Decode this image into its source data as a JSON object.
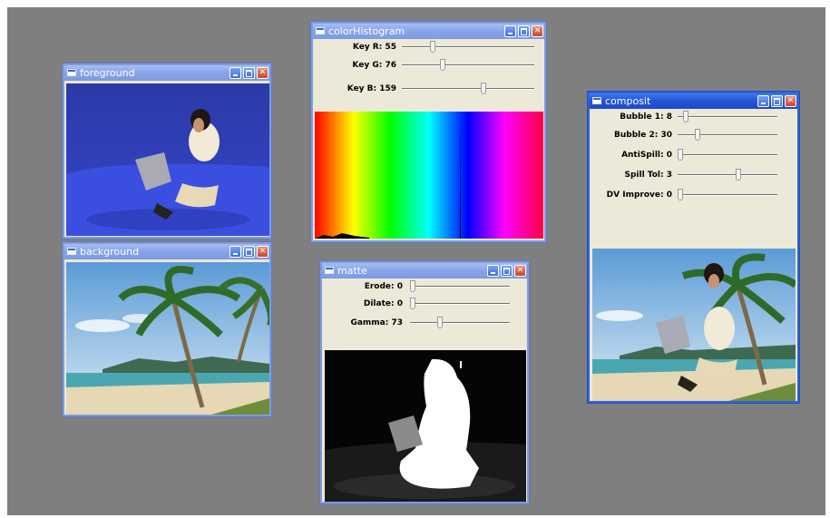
{
  "windows": {
    "foreground": {
      "title": "foreground"
    },
    "background": {
      "title": "background"
    },
    "colorHistogram": {
      "title": "colorHistogram",
      "sliders": [
        {
          "label": "Key R: 55",
          "level": 0.22
        },
        {
          "label": "Key G: 76",
          "level": 0.3
        },
        {
          "label": "Key B: 159",
          "level": 0.62
        }
      ]
    },
    "matte": {
      "title": "matte",
      "sliders": [
        {
          "label": "Erode: 0",
          "level": 0.0
        },
        {
          "label": "Dilate: 0",
          "level": 0.0
        },
        {
          "label": "Gamma: 73",
          "level": 0.29
        }
      ]
    },
    "composit": {
      "title": "composit",
      "sliders": [
        {
          "label": "Bubble 1: 8",
          "level": 0.06
        },
        {
          "label": "Bubble 2: 30",
          "level": 0.18
        },
        {
          "label": "AntiSpill: 0",
          "level": 0.0
        },
        {
          "label": "Spill Tol: 3",
          "level": 0.62
        },
        {
          "label": "DV Improve: 0",
          "level": 0.0
        }
      ]
    }
  },
  "icons": [
    "window-menu-icon",
    "minimize-icon",
    "maximize-icon",
    "close-icon"
  ],
  "colors": {
    "desktop": "#7f7f7f",
    "titlebar_active": "#2456d8",
    "titlebar_inactive": "#8aa6ea",
    "chroma_blue": "#2e3fc4"
  }
}
